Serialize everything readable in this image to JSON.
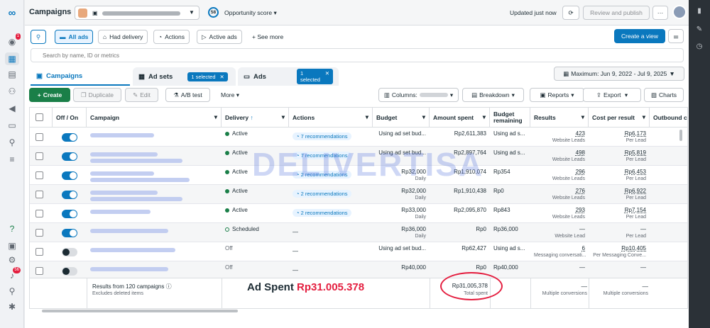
{
  "header": {
    "title": "Campaigns",
    "opportunity_score": "58",
    "opportunity_label": "Opportunity score",
    "updated": "Updated just now",
    "review_btn": "Review and publish",
    "more_btn": "···"
  },
  "filters": {
    "all_ads": "All ads",
    "had_delivery": "Had delivery",
    "actions": "Actions",
    "active_ads": "Active ads",
    "see_more": "See more",
    "create_view": "Create a view"
  },
  "search": {
    "placeholder": "Search by name, ID or metrics"
  },
  "tabs": {
    "campaigns": "Campaigns",
    "ad_sets": "Ad sets",
    "ads": "Ads",
    "adsets_chip": "1 selected",
    "ads_chip": "1 selected",
    "date_range": "Maximum: Jun 9, 2022 - Jul 9, 2025"
  },
  "toolbar": {
    "create": "Create",
    "duplicate": "Duplicate",
    "edit": "Edit",
    "ab_test": "A/B test",
    "more": "More",
    "columns": "Columns:",
    "breakdown": "Breakdown",
    "reports": "Reports",
    "export": "Export",
    "charts": "Charts"
  },
  "columns": [
    "Off / On",
    "Campaign",
    "Delivery",
    "Actions",
    "Budget",
    "Amount spent",
    "Budget remaining",
    "Results",
    "Cost per result",
    "Outbound c"
  ],
  "rows": [
    {
      "on": true,
      "delivery": "Active",
      "actions": "7 recommendations",
      "budget": "Using ad set bud...",
      "budget_sub": "",
      "spent": "Rp2,611,383",
      "remaining": "Using ad s...",
      "results": "423",
      "results_sub": "Website Leads",
      "cpr": "Rp6,173",
      "cpr_sub": "Per Lead"
    },
    {
      "on": true,
      "delivery": "Active",
      "actions": "7 recommendations",
      "budget": "Using ad set bud...",
      "budget_sub": "",
      "spent": "Rp2,897,764",
      "remaining": "Using ad s...",
      "results": "498",
      "results_sub": "Website Leads",
      "cpr": "Rp5,819",
      "cpr_sub": "Per Lead"
    },
    {
      "on": true,
      "delivery": "Active",
      "actions": "2 recommendations",
      "budget": "Rp32,000",
      "budget_sub": "Daily",
      "spent": "Rp1,910,074",
      "remaining": "Rp354",
      "results": "296",
      "results_sub": "Website Leads",
      "cpr": "Rp6,453",
      "cpr_sub": "Per Lead"
    },
    {
      "on": true,
      "delivery": "Active",
      "actions": "2 recommendations",
      "budget": "Rp32,000",
      "budget_sub": "Daily",
      "spent": "Rp1,910,438",
      "remaining": "Rp0",
      "results": "276",
      "results_sub": "Website Leads",
      "cpr": "Rp6,922",
      "cpr_sub": "Per Lead"
    },
    {
      "on": true,
      "delivery": "Active",
      "actions": "2 recommendations",
      "budget": "Rp33,000",
      "budget_sub": "Daily",
      "spent": "Rp2,095,870",
      "remaining": "Rp843",
      "results": "293",
      "results_sub": "Website Leads",
      "cpr": "Rp7,154",
      "cpr_sub": "Per Lead"
    },
    {
      "on": true,
      "delivery": "Scheduled",
      "actions": "—",
      "budget": "Rp36,000",
      "budget_sub": "Daily",
      "spent": "Rp0",
      "remaining": "Rp36,000",
      "results": "—",
      "results_sub": "Website Lead",
      "cpr": "—",
      "cpr_sub": "Per Lead"
    },
    {
      "on": false,
      "delivery": "Off",
      "actions": "—",
      "budget": "Using ad set bud...",
      "budget_sub": "",
      "spent": "Rp62,427",
      "remaining": "Using ad s...",
      "results": "6",
      "results_sub": "Messaging conversati...",
      "cpr": "Rp10,405",
      "cpr_sub": "Per Messaging Conve..."
    },
    {
      "on": false,
      "delivery": "Off",
      "actions": "—",
      "budget": "Rp40,000",
      "budget_sub": "",
      "spent": "Rp0",
      "remaining": "Rp40,000",
      "results": "—",
      "results_sub": "",
      "cpr": "—",
      "cpr_sub": ""
    }
  ],
  "footer": {
    "results_from": "Results from 120 campaigns",
    "excludes": "Excludes deleted items",
    "total_spent": "Rp31,005,378",
    "total_label": "Total spent",
    "results": "—",
    "results_sub": "Multiple conversions",
    "cpr": "—",
    "cpr_sub": "Multiple conversions"
  },
  "annotation": {
    "label": "Ad Spent",
    "value": "Rp31.005.378"
  },
  "watermark": "DELIVERTISA",
  "nav_badges": {
    "notif": "1",
    "alerts": "56"
  },
  "colors": {
    "accent": "#0a78be",
    "create": "#1a7f48",
    "annotation_red": "#e41e3f"
  }
}
